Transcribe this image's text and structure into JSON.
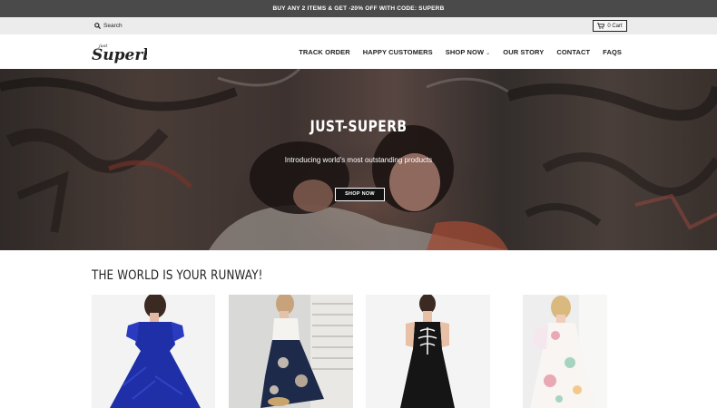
{
  "promo": {
    "text": "BUY ANY 2 ITEMS & GET -20% OFF WITH CODE: SUPERB"
  },
  "utility": {
    "search_label": "Search",
    "cart_label": "0 Cart"
  },
  "header": {
    "logo_text": "Superb",
    "logo_prefix": "just",
    "nav": [
      {
        "label": "TRACK ORDER"
      },
      {
        "label": "HAPPY CUSTOMERS"
      },
      {
        "label": "SHOP NOW",
        "has_dropdown": true
      },
      {
        "label": "OUR STORY"
      },
      {
        "label": "CONTACT"
      },
      {
        "label": "FAQS"
      }
    ]
  },
  "hero": {
    "title": "JUST-SUPERB",
    "subtitle": "Introducing world's most outstanding products",
    "button_label": "SHOP NOW"
  },
  "collection": {
    "title": "THE WORLD IS YOUR RUNWAY!",
    "products": [
      {
        "icon": "blue-lace-dress-image",
        "color": "#1f2fa8"
      },
      {
        "icon": "floral-hilo-dress-image",
        "color": "#1e2a4a"
      },
      {
        "icon": "black-skeleton-dress-image",
        "color": "#151515"
      },
      {
        "icon": "pastel-floral-dress-image",
        "color": "#e8a9b4"
      }
    ]
  },
  "colors": {
    "promo_bg": "#4a4a4a",
    "utility_bg": "#ececec",
    "text": "#222222"
  }
}
